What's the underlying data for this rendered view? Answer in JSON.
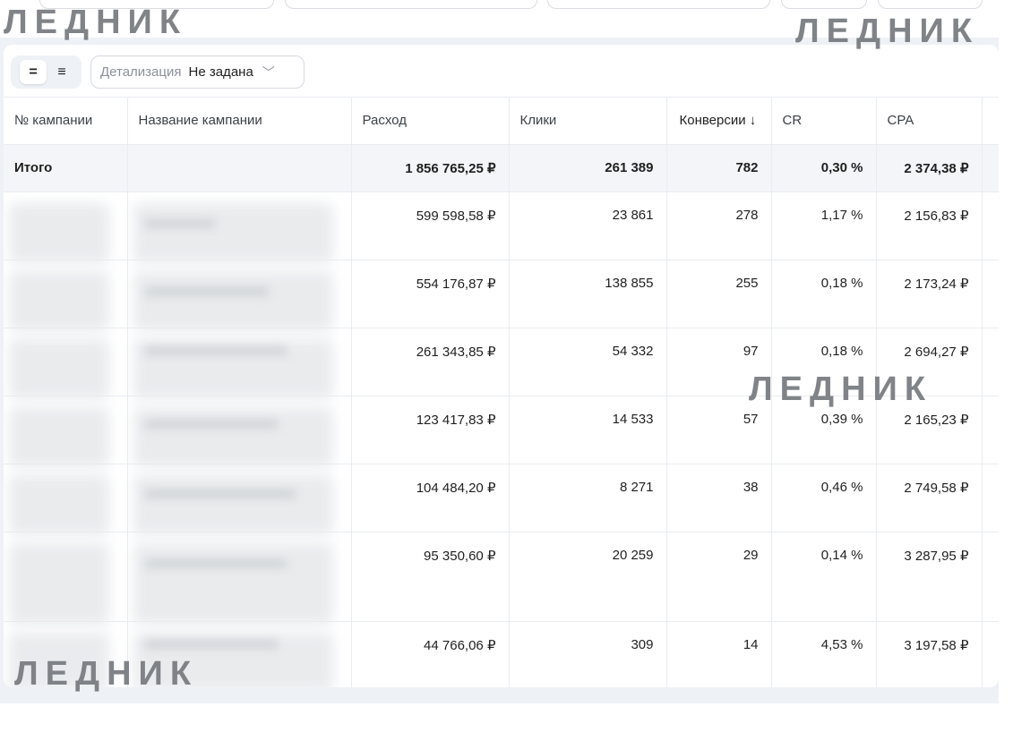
{
  "toolbar": {
    "view_compact_icon": "=",
    "view_list_icon": "≡",
    "detail_label": "Детализация",
    "detail_value": "Не задана",
    "detail_chevron": "﹀"
  },
  "table": {
    "headers": [
      "№ кампании",
      "Название кампании",
      "Расход",
      "Клики",
      "Конверсии ↓",
      "CR",
      "CPA"
    ],
    "total": {
      "label": "Итого",
      "expense": "1 856 765,25 ₽",
      "clicks": "261 389",
      "conversions": "782",
      "cr": "0,30 %",
      "cpa": "2 374,38 ₽"
    },
    "rows": [
      {
        "expense": "599 598,58 ₽",
        "clicks": "23 861",
        "conversions": "278",
        "cr": "1,17 %",
        "cpa": "2 156,83 ₽"
      },
      {
        "expense": "554 176,87 ₽",
        "clicks": "138 855",
        "conversions": "255",
        "cr": "0,18 %",
        "cpa": "2 173,24 ₽"
      },
      {
        "expense": "261 343,85 ₽",
        "clicks": "54 332",
        "conversions": "97",
        "cr": "0,18 %",
        "cpa": "2 694,27 ₽"
      },
      {
        "expense": "123 417,83 ₽",
        "clicks": "14 533",
        "conversions": "57",
        "cr": "0,39 %",
        "cpa": "2 165,23 ₽"
      },
      {
        "expense": "104 484,20 ₽",
        "clicks": "8 271",
        "conversions": "38",
        "cr": "0,46 %",
        "cpa": "2 749,58 ₽"
      },
      {
        "expense": "95 350,60 ₽",
        "clicks": "20 259",
        "conversions": "29",
        "cr": "0,14 %",
        "cpa": "3 287,95 ₽"
      },
      {
        "expense": "44 766,06 ₽",
        "clicks": "309",
        "conversions": "14",
        "cr": "4,53 %",
        "cpa": "3 197,58 ₽"
      }
    ]
  },
  "watermark": "ЛЕДНИК"
}
